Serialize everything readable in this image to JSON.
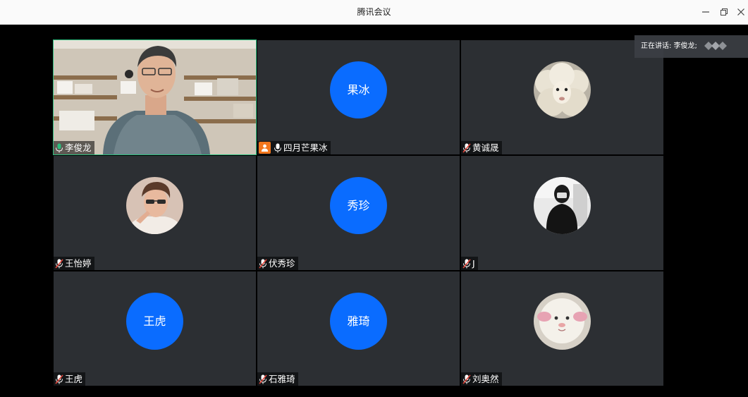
{
  "window": {
    "title": "腾讯会议"
  },
  "speaking": {
    "label": "正在讲话: 李俊龙;"
  },
  "participants": [
    {
      "name": "李俊龙",
      "type": "video",
      "mic": "on",
      "active": true
    },
    {
      "name": "四月芒果冰",
      "type": "initials",
      "initials": "果冰",
      "mic": "on",
      "host": true
    },
    {
      "name": "黄诚晟",
      "type": "photo",
      "photo": "sheep",
      "mic": "muted"
    },
    {
      "name": "王怡婷",
      "type": "photo",
      "photo": "man-portrait",
      "mic": "muted"
    },
    {
      "name": "伏秀珍",
      "type": "initials",
      "initials": "秀珍",
      "mic": "muted"
    },
    {
      "name": "J",
      "type": "photo",
      "photo": "person-black-hoodie",
      "mic": "muted"
    },
    {
      "name": "王虎",
      "type": "initials",
      "initials": "王虎",
      "mic": "muted"
    },
    {
      "name": "石雅琦",
      "type": "initials",
      "initials": "雅琦",
      "mic": "muted"
    },
    {
      "name": "刘奥然",
      "type": "photo",
      "photo": "plush-sheep",
      "mic": "muted"
    }
  ],
  "colors": {
    "initials_bg": "#0a6cff",
    "active_border": "#2dbd7e",
    "host_badge": "#f2761c",
    "mic_on": "#2dbd7e",
    "mic_muted": "#e0453a"
  }
}
